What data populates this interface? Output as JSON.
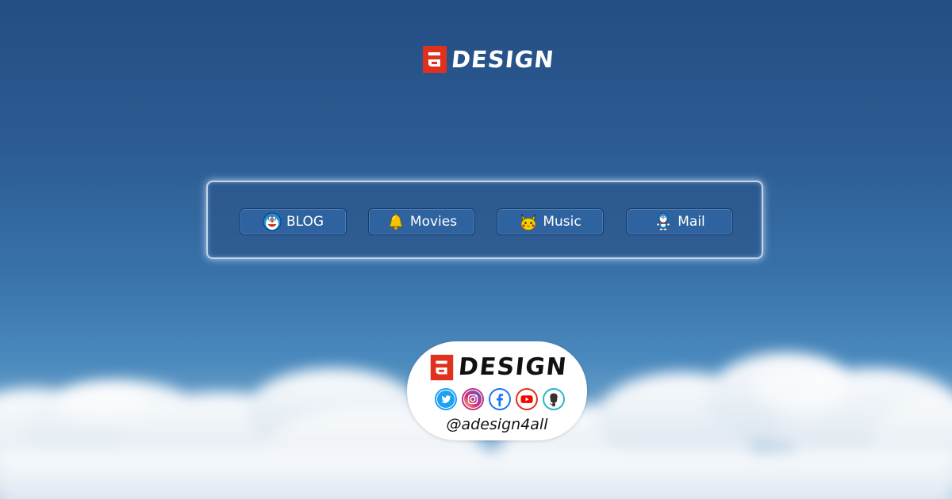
{
  "brand": {
    "word": "DESIGN",
    "mark_color": "#e0301e"
  },
  "nav": {
    "items": [
      {
        "label": "BLOG",
        "icon": "doraemon-face-icon"
      },
      {
        "label": "Movies",
        "icon": "bell-icon"
      },
      {
        "label": "Music",
        "icon": "pikachu-icon"
      },
      {
        "label": "Mail",
        "icon": "doraemon-figure-icon"
      }
    ]
  },
  "badge": {
    "word": "DESIGN",
    "handle": "@adesign4all",
    "socials": [
      {
        "icon": "twitter-icon",
        "color": "#1da1f2"
      },
      {
        "icon": "instagram-icon",
        "color": "#c13584"
      },
      {
        "icon": "facebook-icon",
        "color": "#1877f2"
      },
      {
        "icon": "youtube-icon",
        "color": "#ff0000"
      },
      {
        "icon": "github-icon",
        "color": "#2bb5c8"
      }
    ]
  },
  "colors": {
    "sky_top": "#244d85",
    "sky_bottom": "#b7cfe5",
    "button_bg": "#2f63a0",
    "button_border": "#173a66"
  }
}
